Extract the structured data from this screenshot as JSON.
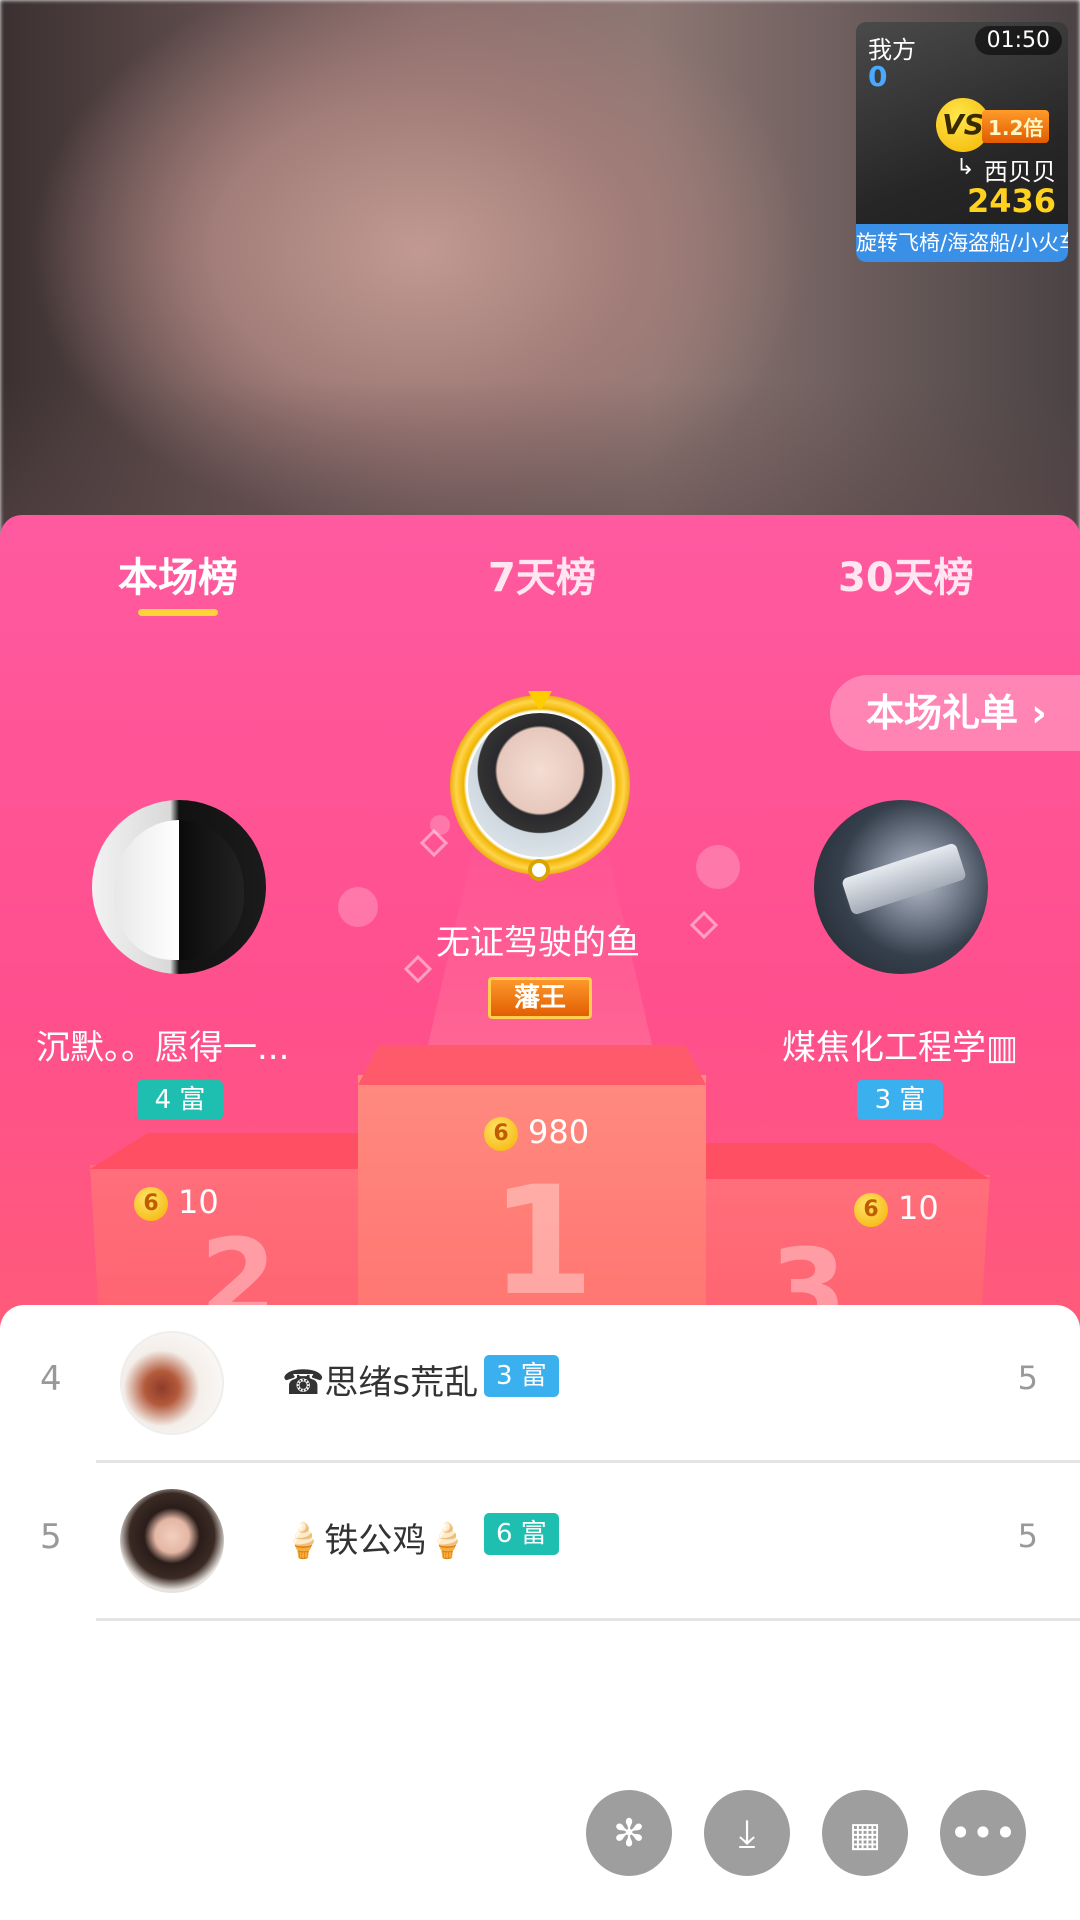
{
  "pk": {
    "me_label": "我方",
    "me_score": "0",
    "timer": "01:50",
    "vs_label": "VS",
    "multiplier": "1.2倍",
    "opponent_name": "西贝贝",
    "opponent_score": "2436",
    "marquee": "旋转飞椅/海盗船/小火车"
  },
  "tabs": [
    "本场榜",
    "7天榜",
    "30天榜"
  ],
  "active_tab": 0,
  "gift_list_button": "本场礼单 ›",
  "podium": {
    "first": {
      "name": "无证驾驶的鱼",
      "title_badge": "藩王",
      "coins": "980",
      "rank_digit": "1"
    },
    "second": {
      "name": "沉默。。愿得一...",
      "badge": "4 富",
      "coins": "10",
      "rank_digit": "2"
    },
    "third": {
      "name": "煤焦化工程学▥",
      "badge": "3 富",
      "coins": "10",
      "rank_digit": "3"
    },
    "coin_glyph": "6"
  },
  "list": [
    {
      "rank": "4",
      "name": "☎思绪s荒乱",
      "badge": "3 富",
      "badge_color": "#3ab0ee",
      "score": "5"
    },
    {
      "rank": "5",
      "name": "🍦铁公鸡🍦",
      "badge": "6 富",
      "badge_color": "#1ebfb0",
      "score": "5"
    }
  ],
  "bottom_buttons": [
    {
      "name": "sparkle",
      "icon": "sparkle-icon"
    },
    {
      "name": "download",
      "icon": "download-icon"
    },
    {
      "name": "apps",
      "icon": "grid-icon"
    },
    {
      "name": "more",
      "icon": "more-icon"
    }
  ]
}
